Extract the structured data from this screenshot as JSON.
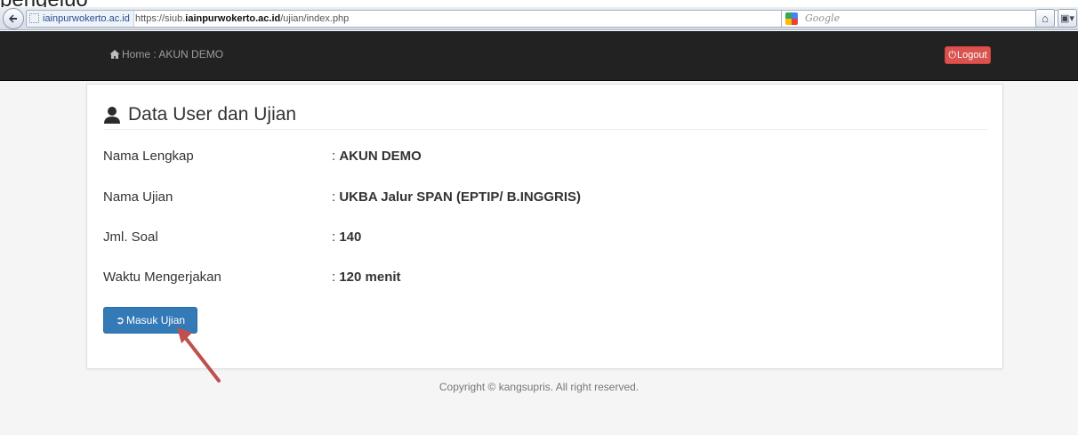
{
  "browser": {
    "site_identity": "iainpurwokerto.ac.id",
    "url_prefix": "https://siub.",
    "url_domain": "iainpurwokerto.ac.id",
    "url_path": "/ujian/index.php",
    "search_placeholder": "Google",
    "caption": "pengeluo"
  },
  "navbar": {
    "home_label": "Home : AKUN DEMO",
    "logout_label": "Logout",
    "logout_color": "#d9534f"
  },
  "panel": {
    "title": "Data User dan Ujian",
    "rows": [
      {
        "label": "Nama Lengkap",
        "value": "AKUN DEMO"
      },
      {
        "label": "Nama Ujian",
        "value": "UKBA Jalur SPAN (EPTIP/ B.INGGRIS)"
      },
      {
        "label": "Jml. Soal",
        "value": "140"
      },
      {
        "label": "Waktu Mengerjakan",
        "value": "120 menit"
      }
    ],
    "button_label": "Masuk Ujian",
    "button_color": "#337ab7"
  },
  "footer": {
    "text": "Copyright © kangsupris. All right reserved."
  }
}
